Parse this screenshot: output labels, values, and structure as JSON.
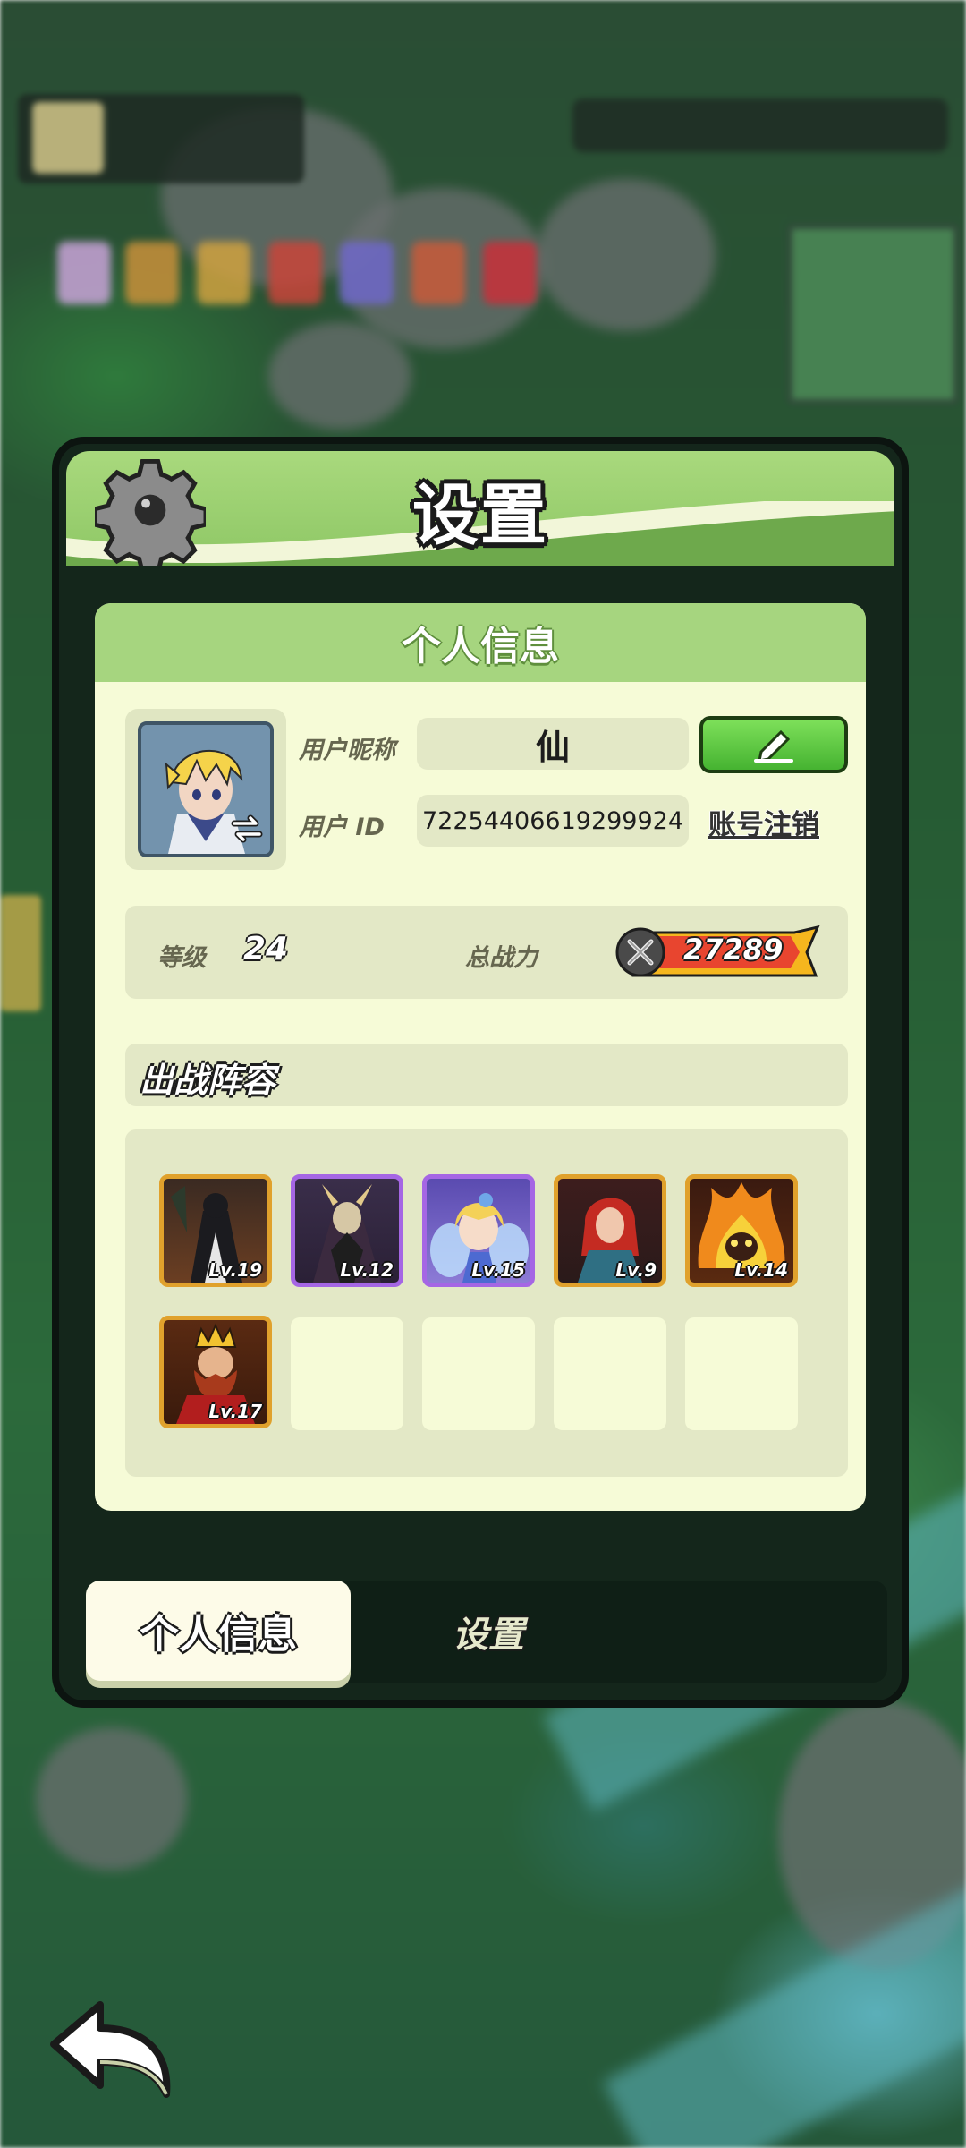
{
  "dialog": {
    "title": "设置",
    "section_title": "个人信息",
    "profile": {
      "nickname_label": "用户昵称",
      "nickname_value": "仙",
      "id_label": "用户 ID",
      "id_value": "72254406619299924",
      "cancel_account": "账号注销"
    },
    "stats": {
      "level_label": "等级",
      "level_value": "24",
      "power_label": "总战力",
      "power_value": "27289"
    },
    "lineup": {
      "title": "出战阵容",
      "heroes": [
        {
          "level": "Lv.19",
          "rarity": "orange",
          "theme": "dark-robed-mage"
        },
        {
          "level": "Lv.12",
          "rarity": "purple",
          "theme": "horned-sorcerer"
        },
        {
          "level": "Lv.15",
          "rarity": "purple",
          "theme": "fairy-girl"
        },
        {
          "level": "Lv.9",
          "rarity": "orange",
          "theme": "red-haired-warrior"
        },
        {
          "level": "Lv.14",
          "rarity": "orange",
          "theme": "fire-demon"
        },
        {
          "level": "Lv.17",
          "rarity": "orange",
          "theme": "crowned-dwarf-king"
        }
      ],
      "empty_slots": 4
    },
    "tabs": [
      {
        "label": "个人信息",
        "active": true
      },
      {
        "label": "设置",
        "active": false
      }
    ]
  },
  "colors": {
    "header_green": "#a9d97d",
    "panel_bg": "#f6fbd7",
    "edit_button": "#5ccc3f",
    "orange_frame": "#e0a12c",
    "purple_frame": "#a566e4"
  },
  "icons": {
    "settings": "gear-icon",
    "edit": "pencil-icon",
    "swap_avatar": "swap-arrows-icon",
    "power": "crossed-swords-icon",
    "back": "back-arrow-icon"
  }
}
